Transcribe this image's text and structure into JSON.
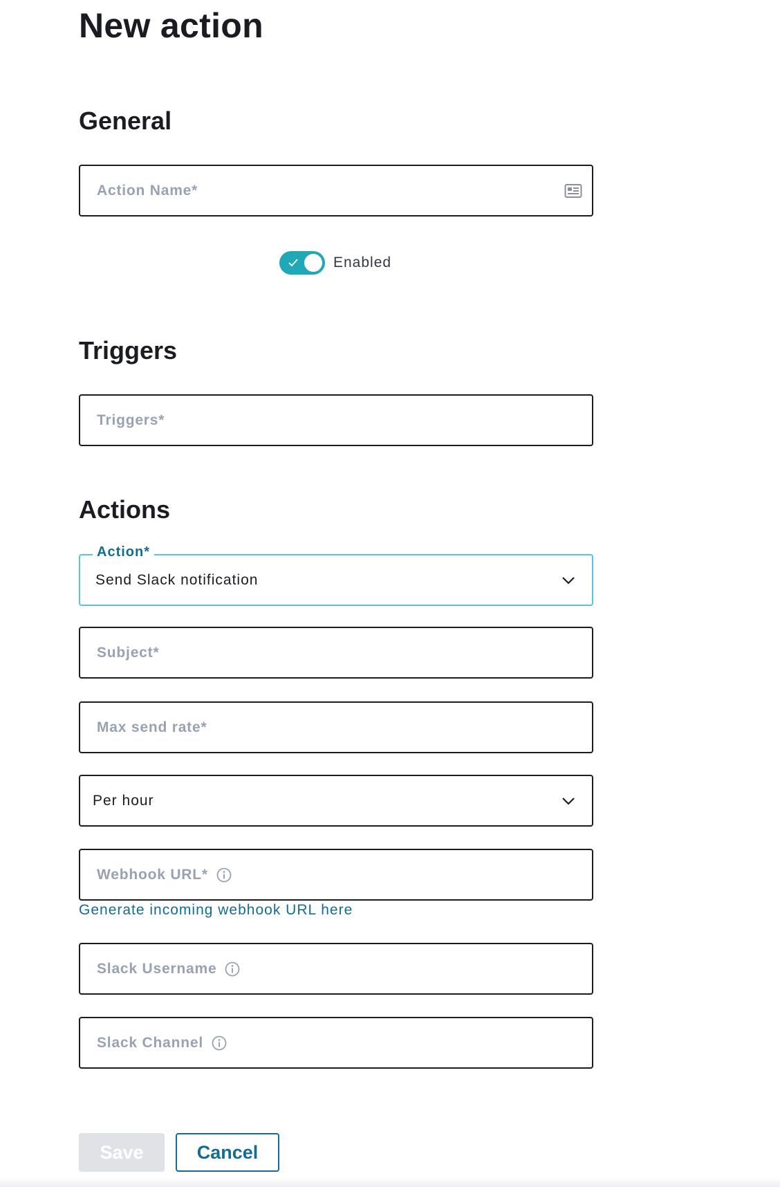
{
  "page": {
    "title": "New action"
  },
  "general": {
    "heading": "General",
    "action_name_placeholder": "Action Name*",
    "enabled_label": "Enabled",
    "enabled": true
  },
  "triggers": {
    "heading": "Triggers",
    "triggers_placeholder": "Triggers*"
  },
  "actions": {
    "heading": "Actions",
    "action_select": {
      "label": "Action*",
      "value": "Send Slack notification"
    },
    "subject_placeholder": "Subject*",
    "max_send_rate_placeholder": "Max send rate*",
    "rate_period": {
      "value": "Per hour"
    },
    "webhook_url_placeholder": "Webhook URL*",
    "webhook_link": "Generate incoming webhook URL here",
    "slack_username_placeholder": "Slack Username",
    "slack_channel_placeholder": "Slack Channel"
  },
  "buttons": {
    "save_label": "Save",
    "cancel_label": "Cancel"
  },
  "colors": {
    "accent": "#136c92",
    "toggle": "#1fa8b7",
    "focus_border": "#55c4dd",
    "placeholder": "#98a2b3",
    "disabled_button": "#e0e2e7"
  },
  "icons": {
    "action_name": "id-card-icon",
    "toggle_check": "check-icon",
    "select": "chevron-down-icon",
    "help": "info-icon"
  }
}
